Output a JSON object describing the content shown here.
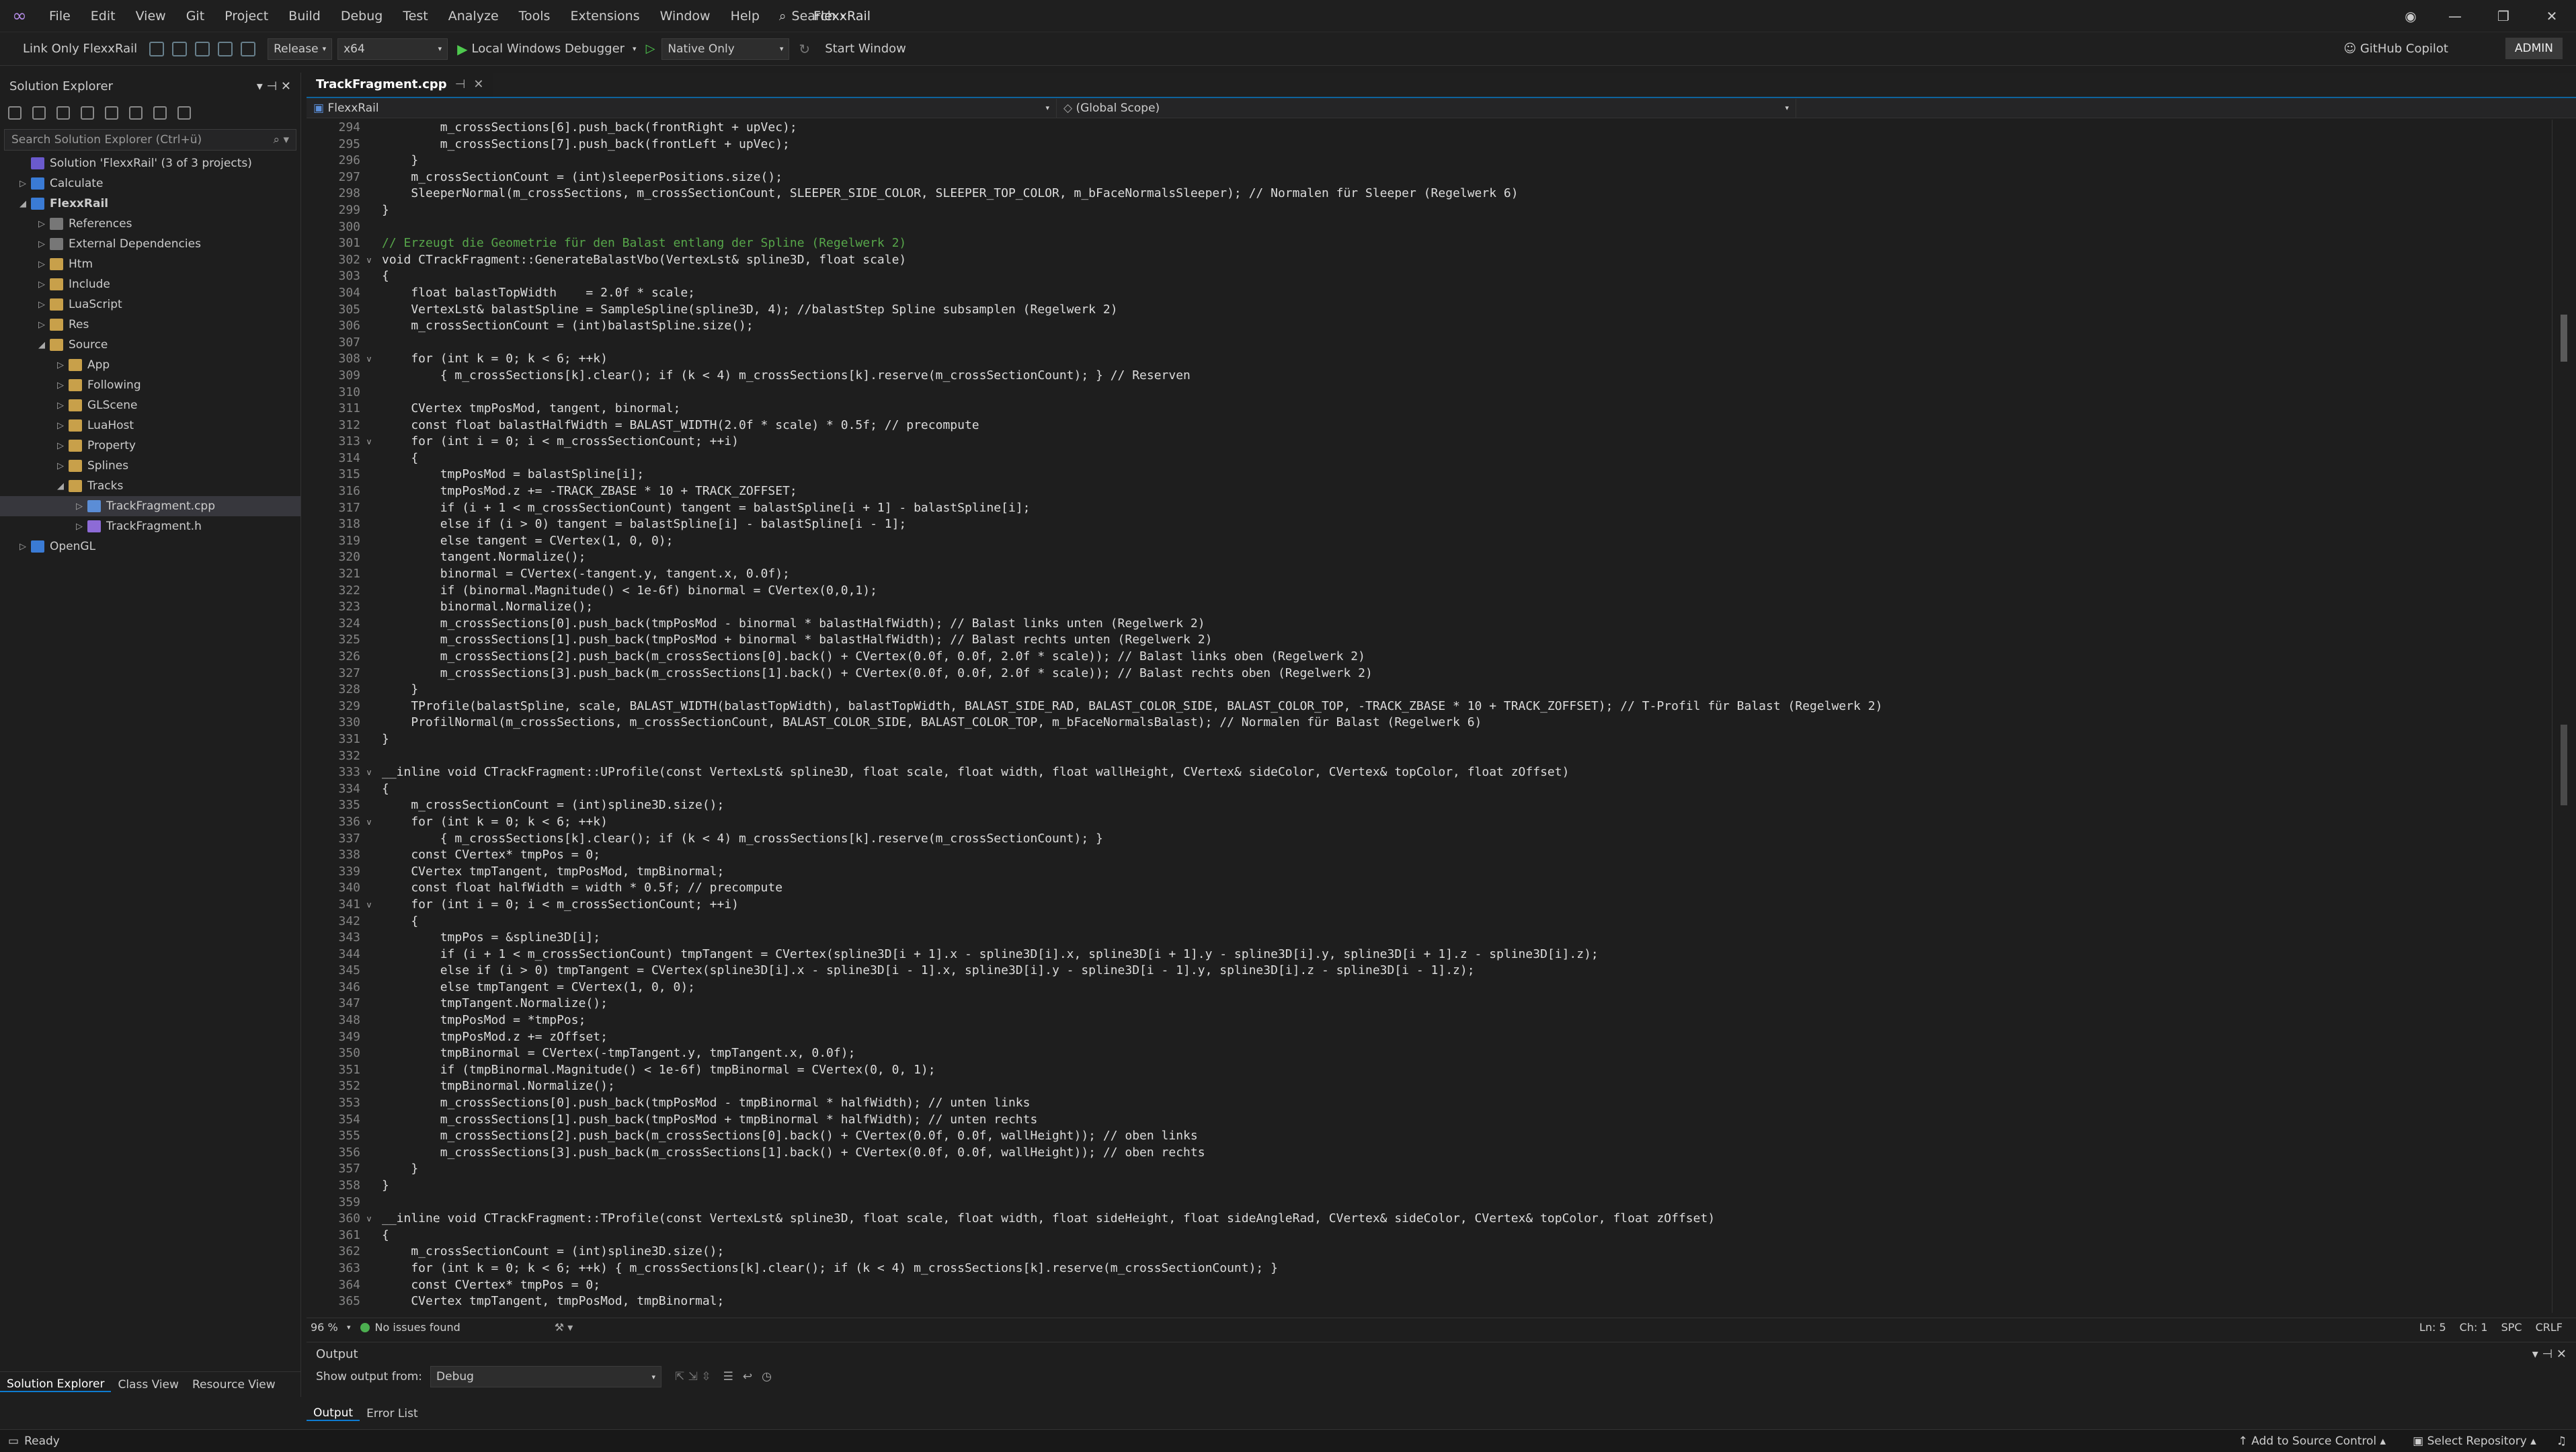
{
  "menu": [
    "File",
    "Edit",
    "View",
    "Git",
    "Project",
    "Build",
    "Debug",
    "Test",
    "Analyze",
    "Tools",
    "Extensions",
    "Window",
    "Help"
  ],
  "search_label": "Search",
  "app_title": "FlexxRail",
  "toolbar": {
    "link_only": "Link Only FlexxRail",
    "config": "Release",
    "platform": "x64",
    "debugger": "Local Windows Debugger",
    "debug_mode": "Native Only",
    "start_window": "Start Window",
    "copilot": "GitHub Copilot",
    "admin": "ADMIN"
  },
  "solution_explorer": {
    "title": "Solution Explorer",
    "search_placeholder": "Search Solution Explorer (Ctrl+ü)",
    "tree": [
      {
        "label": "Solution 'FlexxRail' (3 of 3 projects)",
        "indent": 0,
        "icon": "sol",
        "tw": ""
      },
      {
        "label": "Calculate",
        "indent": 0,
        "icon": "proj",
        "tw": "▷"
      },
      {
        "label": "FlexxRail",
        "indent": 0,
        "icon": "proj",
        "tw": "◢",
        "bold": true
      },
      {
        "label": "References",
        "indent": 1,
        "icon": "ref",
        "tw": "▷"
      },
      {
        "label": "External Dependencies",
        "indent": 1,
        "icon": "ref",
        "tw": "▷"
      },
      {
        "label": "Htm",
        "indent": 1,
        "icon": "fold",
        "tw": "▷"
      },
      {
        "label": "Include",
        "indent": 1,
        "icon": "fold",
        "tw": "▷"
      },
      {
        "label": "LuaScript",
        "indent": 1,
        "icon": "fold",
        "tw": "▷"
      },
      {
        "label": "Res",
        "indent": 1,
        "icon": "fold",
        "tw": "▷"
      },
      {
        "label": "Source",
        "indent": 1,
        "icon": "fold",
        "tw": "◢"
      },
      {
        "label": "App",
        "indent": 2,
        "icon": "fold",
        "tw": "▷"
      },
      {
        "label": "Following",
        "indent": 2,
        "icon": "fold",
        "tw": "▷"
      },
      {
        "label": "GLScene",
        "indent": 2,
        "icon": "fold",
        "tw": "▷"
      },
      {
        "label": "LuaHost",
        "indent": 2,
        "icon": "fold",
        "tw": "▷"
      },
      {
        "label": "Property",
        "indent": 2,
        "icon": "fold",
        "tw": "▷"
      },
      {
        "label": "Splines",
        "indent": 2,
        "icon": "fold",
        "tw": "▷"
      },
      {
        "label": "Tracks",
        "indent": 2,
        "icon": "fold",
        "tw": "◢"
      },
      {
        "label": "TrackFragment.cpp",
        "indent": 3,
        "icon": "cpp",
        "tw": "▷",
        "selected": true
      },
      {
        "label": "TrackFragment.h",
        "indent": 3,
        "icon": "h",
        "tw": "▷"
      },
      {
        "label": "OpenGL",
        "indent": 0,
        "icon": "proj",
        "tw": "▷"
      }
    ],
    "tabs": [
      "Solution Explorer",
      "Class View",
      "Resource View"
    ]
  },
  "editor": {
    "tab_label": "TrackFragment.cpp",
    "nav_project": "FlexxRail",
    "nav_scope": "(Global Scope)",
    "zoom": "96 %",
    "issues": "No issues found",
    "ln": "Ln: 5",
    "ch": "Ch: 1",
    "spc": "SPC",
    "crlf": "CRLF"
  },
  "code_lines": [
    {
      "n": "294",
      "t": "        m_crossSections[6].push_back(frontRight + upVec);"
    },
    {
      "n": "295",
      "t": "        m_crossSections[7].push_back(frontLeft + upVec);"
    },
    {
      "n": "296",
      "t": "    }"
    },
    {
      "n": "297",
      "t": "    m_crossSectionCount = (int)sleeperPositions.size();"
    },
    {
      "n": "298",
      "t": "    SleeperNormal(m_crossSections, m_crossSectionCount, SLEEPER_SIDE_COLOR, SLEEPER_TOP_COLOR, m_bFaceNormalsSleeper); // Normalen für Sleeper (Regelwerk 6)"
    },
    {
      "n": "299",
      "t": "}"
    },
    {
      "n": "300",
      "t": ""
    },
    {
      "n": "301",
      "t": "// Erzeugt die Geometrie für den Balast entlang der Spline (Regelwerk 2)"
    },
    {
      "n": "302",
      "t": "void CTrackFragment::GenerateBalastVbo(VertexLst& spline3D, float scale)",
      "f": "v"
    },
    {
      "n": "303",
      "t": "{"
    },
    {
      "n": "304",
      "t": "    float balastTopWidth    = 2.0f * scale;"
    },
    {
      "n": "305",
      "t": "    VertexLst& balastSpline = SampleSpline(spline3D, 4); //balastStep Spline subsamplen (Regelwerk 2)"
    },
    {
      "n": "306",
      "t": "    m_crossSectionCount = (int)balastSpline.size();"
    },
    {
      "n": "307",
      "t": ""
    },
    {
      "n": "308",
      "t": "    for (int k = 0; k < 6; ++k)",
      "f": "v"
    },
    {
      "n": "309",
      "t": "        { m_crossSections[k].clear(); if (k < 4) m_crossSections[k].reserve(m_crossSectionCount); } // Reserven"
    },
    {
      "n": "310",
      "t": ""
    },
    {
      "n": "311",
      "t": "    CVertex tmpPosMod, tangent, binormal;"
    },
    {
      "n": "312",
      "t": "    const float balastHalfWidth = BALAST_WIDTH(2.0f * scale) * 0.5f; // precompute"
    },
    {
      "n": "313",
      "t": "    for (int i = 0; i < m_crossSectionCount; ++i)",
      "f": "v"
    },
    {
      "n": "314",
      "t": "    {"
    },
    {
      "n": "315",
      "t": "        tmpPosMod = balastSpline[i];"
    },
    {
      "n": "316",
      "t": "        tmpPosMod.z += -TRACK_ZBASE * 10 + TRACK_ZOFFSET;"
    },
    {
      "n": "317",
      "t": "        if (i + 1 < m_crossSectionCount) tangent = balastSpline[i + 1] - balastSpline[i];"
    },
    {
      "n": "318",
      "t": "        else if (i > 0) tangent = balastSpline[i] - balastSpline[i - 1];"
    },
    {
      "n": "319",
      "t": "        else tangent = CVertex(1, 0, 0);"
    },
    {
      "n": "320",
      "t": "        tangent.Normalize();"
    },
    {
      "n": "321",
      "t": "        binormal = CVertex(-tangent.y, tangent.x, 0.0f);"
    },
    {
      "n": "322",
      "t": "        if (binormal.Magnitude() < 1e-6f) binormal = CVertex(0,0,1);"
    },
    {
      "n": "323",
      "t": "        binormal.Normalize();"
    },
    {
      "n": "324",
      "t": "        m_crossSections[0].push_back(tmpPosMod - binormal * balastHalfWidth); // Balast links unten (Regelwerk 2)"
    },
    {
      "n": "325",
      "t": "        m_crossSections[1].push_back(tmpPosMod + binormal * balastHalfWidth); // Balast rechts unten (Regelwerk 2)"
    },
    {
      "n": "326",
      "t": "        m_crossSections[2].push_back(m_crossSections[0].back() + CVertex(0.0f, 0.0f, 2.0f * scale)); // Balast links oben (Regelwerk 2)"
    },
    {
      "n": "327",
      "t": "        m_crossSections[3].push_back(m_crossSections[1].back() + CVertex(0.0f, 0.0f, 2.0f * scale)); // Balast rechts oben (Regelwerk 2)"
    },
    {
      "n": "328",
      "t": "    }"
    },
    {
      "n": "329",
      "t": "    TProfile(balastSpline, scale, BALAST_WIDTH(balastTopWidth), balastTopWidth, BALAST_SIDE_RAD, BALAST_COLOR_SIDE, BALAST_COLOR_TOP, -TRACK_ZBASE * 10 + TRACK_ZOFFSET); // T-Profil für Balast (Regelwerk 2)"
    },
    {
      "n": "330",
      "t": "    ProfilNormal(m_crossSections, m_crossSectionCount, BALAST_COLOR_SIDE, BALAST_COLOR_TOP, m_bFaceNormalsBalast); // Normalen für Balast (Regelwerk 6)"
    },
    {
      "n": "331",
      "t": "}"
    },
    {
      "n": "332",
      "t": ""
    },
    {
      "n": "333",
      "t": "__inline void CTrackFragment::UProfile(const VertexLst& spline3D, float scale, float width, float wallHeight, CVertex& sideColor, CVertex& topColor, float zOffset)",
      "f": "v"
    },
    {
      "n": "334",
      "t": "{"
    },
    {
      "n": "335",
      "t": "    m_crossSectionCount = (int)spline3D.size();"
    },
    {
      "n": "336",
      "t": "    for (int k = 0; k < 6; ++k)",
      "f": "v"
    },
    {
      "n": "337",
      "t": "        { m_crossSections[k].clear(); if (k < 4) m_crossSections[k].reserve(m_crossSectionCount); }"
    },
    {
      "n": "338",
      "t": "    const CVertex* tmpPos = 0;"
    },
    {
      "n": "339",
      "t": "    CVertex tmpTangent, tmpPosMod, tmpBinormal;"
    },
    {
      "n": "340",
      "t": "    const float halfWidth = width * 0.5f; // precompute"
    },
    {
      "n": "341",
      "t": "    for (int i = 0; i < m_crossSectionCount; ++i)",
      "f": "v"
    },
    {
      "n": "342",
      "t": "    {"
    },
    {
      "n": "343",
      "t": "        tmpPos = &spline3D[i];"
    },
    {
      "n": "344",
      "t": "        if (i + 1 < m_crossSectionCount) tmpTangent = CVertex(spline3D[i + 1].x - spline3D[i].x, spline3D[i + 1].y - spline3D[i].y, spline3D[i + 1].z - spline3D[i].z);"
    },
    {
      "n": "345",
      "t": "        else if (i > 0) tmpTangent = CVertex(spline3D[i].x - spline3D[i - 1].x, spline3D[i].y - spline3D[i - 1].y, spline3D[i].z - spline3D[i - 1].z);"
    },
    {
      "n": "346",
      "t": "        else tmpTangent = CVertex(1, 0, 0);"
    },
    {
      "n": "347",
      "t": "        tmpTangent.Normalize();"
    },
    {
      "n": "348",
      "t": "        tmpPosMod = *tmpPos;"
    },
    {
      "n": "349",
      "t": "        tmpPosMod.z += zOffset;"
    },
    {
      "n": "350",
      "t": "        tmpBinormal = CVertex(-tmpTangent.y, tmpTangent.x, 0.0f);"
    },
    {
      "n": "351",
      "t": "        if (tmpBinormal.Magnitude() < 1e-6f) tmpBinormal = CVertex(0, 0, 1);"
    },
    {
      "n": "352",
      "t": "        tmpBinormal.Normalize();"
    },
    {
      "n": "353",
      "t": "        m_crossSections[0].push_back(tmpPosMod - tmpBinormal * halfWidth); // unten links"
    },
    {
      "n": "354",
      "t": "        m_crossSections[1].push_back(tmpPosMod + tmpBinormal * halfWidth); // unten rechts"
    },
    {
      "n": "355",
      "t": "        m_crossSections[2].push_back(m_crossSections[0].back() + CVertex(0.0f, 0.0f, wallHeight)); // oben links"
    },
    {
      "n": "356",
      "t": "        m_crossSections[3].push_back(m_crossSections[1].back() + CVertex(0.0f, 0.0f, wallHeight)); // oben rechts"
    },
    {
      "n": "357",
      "t": "    }"
    },
    {
      "n": "358",
      "t": "}"
    },
    {
      "n": "359",
      "t": ""
    },
    {
      "n": "360",
      "t": "__inline void CTrackFragment::TProfile(const VertexLst& spline3D, float scale, float width, float sideHeight, float sideAngleRad, CVertex& sideColor, CVertex& topColor, float zOffset)",
      "f": "v"
    },
    {
      "n": "361",
      "t": "{"
    },
    {
      "n": "362",
      "t": "    m_crossSectionCount = (int)spline3D.size();"
    },
    {
      "n": "363",
      "t": "    for (int k = 0; k < 6; ++k) { m_crossSections[k].clear(); if (k < 4) m_crossSections[k].reserve(m_crossSectionCount); }"
    },
    {
      "n": "364",
      "t": "    const CVertex* tmpPos = 0;"
    },
    {
      "n": "365",
      "t": "    CVertex tmpTangent, tmpPosMod, tmpBinormal;"
    }
  ],
  "output": {
    "title": "Output",
    "show_from_label": "Show output from:",
    "show_from_value": "Debug",
    "tabs": [
      "Output",
      "Error List"
    ]
  },
  "status": {
    "ready": "Ready",
    "add_source": "Add to Source Control",
    "select_repo": "Select Repository"
  }
}
